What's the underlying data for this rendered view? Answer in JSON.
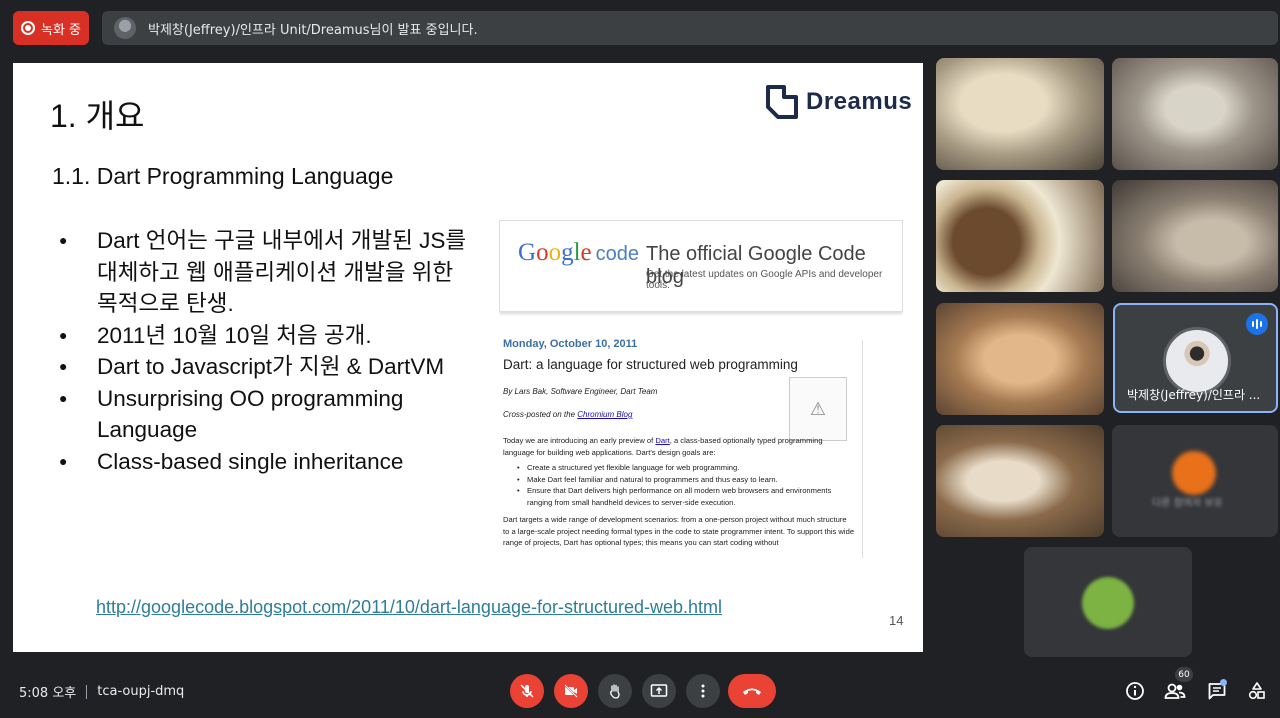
{
  "topbar": {
    "recording_label": "녹화 중",
    "presenting_text": "박제창(Jeffrey)/인프라 Unit/Dreamus님이 발표 중입니다."
  },
  "slide": {
    "title": "1.  개요",
    "subtitle": "1.1. Dart Programming Language",
    "logo_text": "Dreamus",
    "bullets": [
      "Dart 언어는 구글 내부에서 개발된 JS를 대체하고 웹 애플리케이션 개발을 위한 목적으로 탄생.",
      "2011년 10월 10일 처음 공개.",
      "Dart to Javascript가 지원 & DartVM",
      "Unsurprising OO programming Language",
      "Class-based single inheritance"
    ],
    "link": "http://googlecode.blogspot.com/2011/10/dart-language-for-structured-web.html",
    "page_number": "14",
    "blog": {
      "logo_google": "Google",
      "logo_code": "code",
      "title": "The official Google Code blog",
      "tagline": "Get the latest updates on Google APIs and developer tools.",
      "date": "Monday, October 10, 2011",
      "post_title": "Dart: a language for structured web programming",
      "author": "By Lars Bak, Software Engineer, Dart Team",
      "cross_prefix": "Cross-posted on the ",
      "cross_link": "Chromium Blog",
      "intro_a": "Today we are introducing an early preview of ",
      "intro_link": "Dart",
      "intro_b": ", a class-based optionally typed programming language for building web applications. Dart's design goals are:",
      "goals": [
        "Create a structured yet flexible language for web programming.",
        "Make Dart feel familiar and natural to programmers and thus easy to learn.",
        "Ensure that Dart delivers high performance on all modern web browsers and environments ranging from small handheld devices to server-side execution."
      ],
      "para2": "Dart targets a wide range of development scenarios: from a one-person project without much structure to a large-scale project needing formal types in the code to state programmer intent. To support this wide range of projects, Dart has optional types; this means you can start coding without"
    }
  },
  "participants": {
    "presenter_name": "박제창(Jeffrey)/인프라 ...",
    "faint_name": "다른 참여자 보유"
  },
  "bottombar": {
    "time": "5:08 오후",
    "meeting_code": "tca-oupj-dmq",
    "people_count": "60"
  },
  "colors": {
    "accent": "#8ab4f8",
    "danger": "#ea4335",
    "background": "#202124"
  }
}
